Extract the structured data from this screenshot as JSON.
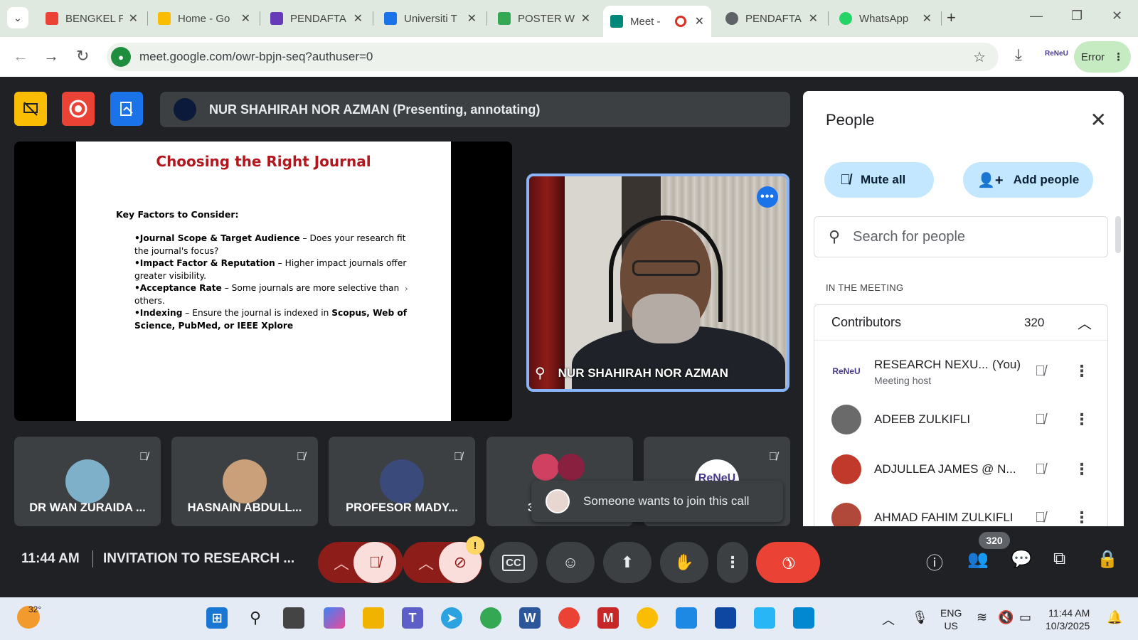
{
  "browser": {
    "tabs": [
      {
        "title": "BENGKEL F",
        "favicon": "gmail-icon",
        "color": "#ea4335"
      },
      {
        "title": "Home - Go",
        "favicon": "google-drive-icon",
        "color": "#fbbc04"
      },
      {
        "title": "PENDAFTA",
        "favicon": "google-forms-icon",
        "color": "#673ab7"
      },
      {
        "title": "Universiti T",
        "favicon": "calendar-icon",
        "color": "#1a73e8"
      },
      {
        "title": "POSTER W",
        "favicon": "google-drive-icon",
        "color": "#34a853"
      },
      {
        "title": "Meet -",
        "favicon": "google-meet-icon",
        "color": "#00897b",
        "active": true,
        "recording": true
      },
      {
        "title": "PENDAFTA",
        "favicon": "globe-icon",
        "color": "#5f6368"
      },
      {
        "title": "WhatsApp",
        "favicon": "whatsapp-icon",
        "color": "#25d366"
      }
    ],
    "url": "meet.google.com/owr-bpjn-seq?authuser=0",
    "profile_label": "ReNeU",
    "error_label": "Error"
  },
  "meet": {
    "presenting_text": "NUR SHAHIRAH NOR AZMAN (Presenting, annotating)",
    "slide": {
      "title": "Choosing the Right Journal",
      "subtitle": "Key Factors to Consider:",
      "bullets": [
        {
          "bold": "•Journal Scope & Target Audience",
          "text": " – Does your research fit the journal's focus?"
        },
        {
          "bold": "•Impact Factor & Reputation",
          "text": " – Higher impact journals offer greater visibility."
        },
        {
          "bold": "•Acceptance Rate",
          "text": " – Some journals are more selective than others."
        },
        {
          "bold": "•Indexing",
          "text": " – Ensure the journal is indexed in ",
          "bold2": "Scopus, Web of Science, PubMed, or IEEE Xplore"
        }
      ],
      "arrow": "›"
    },
    "speaker_name": "NUR SHAHIRAH NOR AZMAN",
    "speaker_more": "•••",
    "tiles": [
      {
        "name": "DR WAN ZURAIDA ...",
        "avatar_color": "#7fb0c9"
      },
      {
        "name": "HASNAIN ABDULL...",
        "avatar_color": "#c9a07a"
      },
      {
        "name": "PROFESOR MADY...",
        "avatar_color": "#3a4a7a"
      },
      {
        "name": "3",
        "avatar_color": "#d04060"
      },
      {
        "name": "ReNeU",
        "avatar_color": "#ffffff"
      }
    ],
    "toast_text": "Someone wants to join this call",
    "people_panel": {
      "title": "People",
      "mute_all": "Mute all",
      "add_people": "Add people",
      "search_placeholder": "Search for people",
      "section": "IN THE MEETING",
      "group_label": "Contributors",
      "group_count": "320",
      "rows": [
        {
          "name": "RESEARCH NEXU...",
          "you": "(You)",
          "sub": "Meeting host",
          "avatar_text": "ReNeU",
          "avatar_color": "#ffffff"
        },
        {
          "name": "ADEEB ZULKIFLI",
          "avatar_color": "#6a6a6a"
        },
        {
          "name": "ADJULLEA JAMES @ N...",
          "avatar_color": "#c0392b"
        },
        {
          "name": "AHMAD FAHIM ZULKIFLI",
          "avatar_color": "#b0493a"
        }
      ]
    },
    "controls": {
      "time": "11:44 AM",
      "meeting_title": "INVITATION TO RESEARCH ...",
      "people_count": "320",
      "camera_warning": "!"
    }
  },
  "taskbar": {
    "temperature": "32°",
    "language_top": "ENG",
    "language_bottom": "US",
    "time": "11:44 AM",
    "date": "10/3/2025"
  }
}
